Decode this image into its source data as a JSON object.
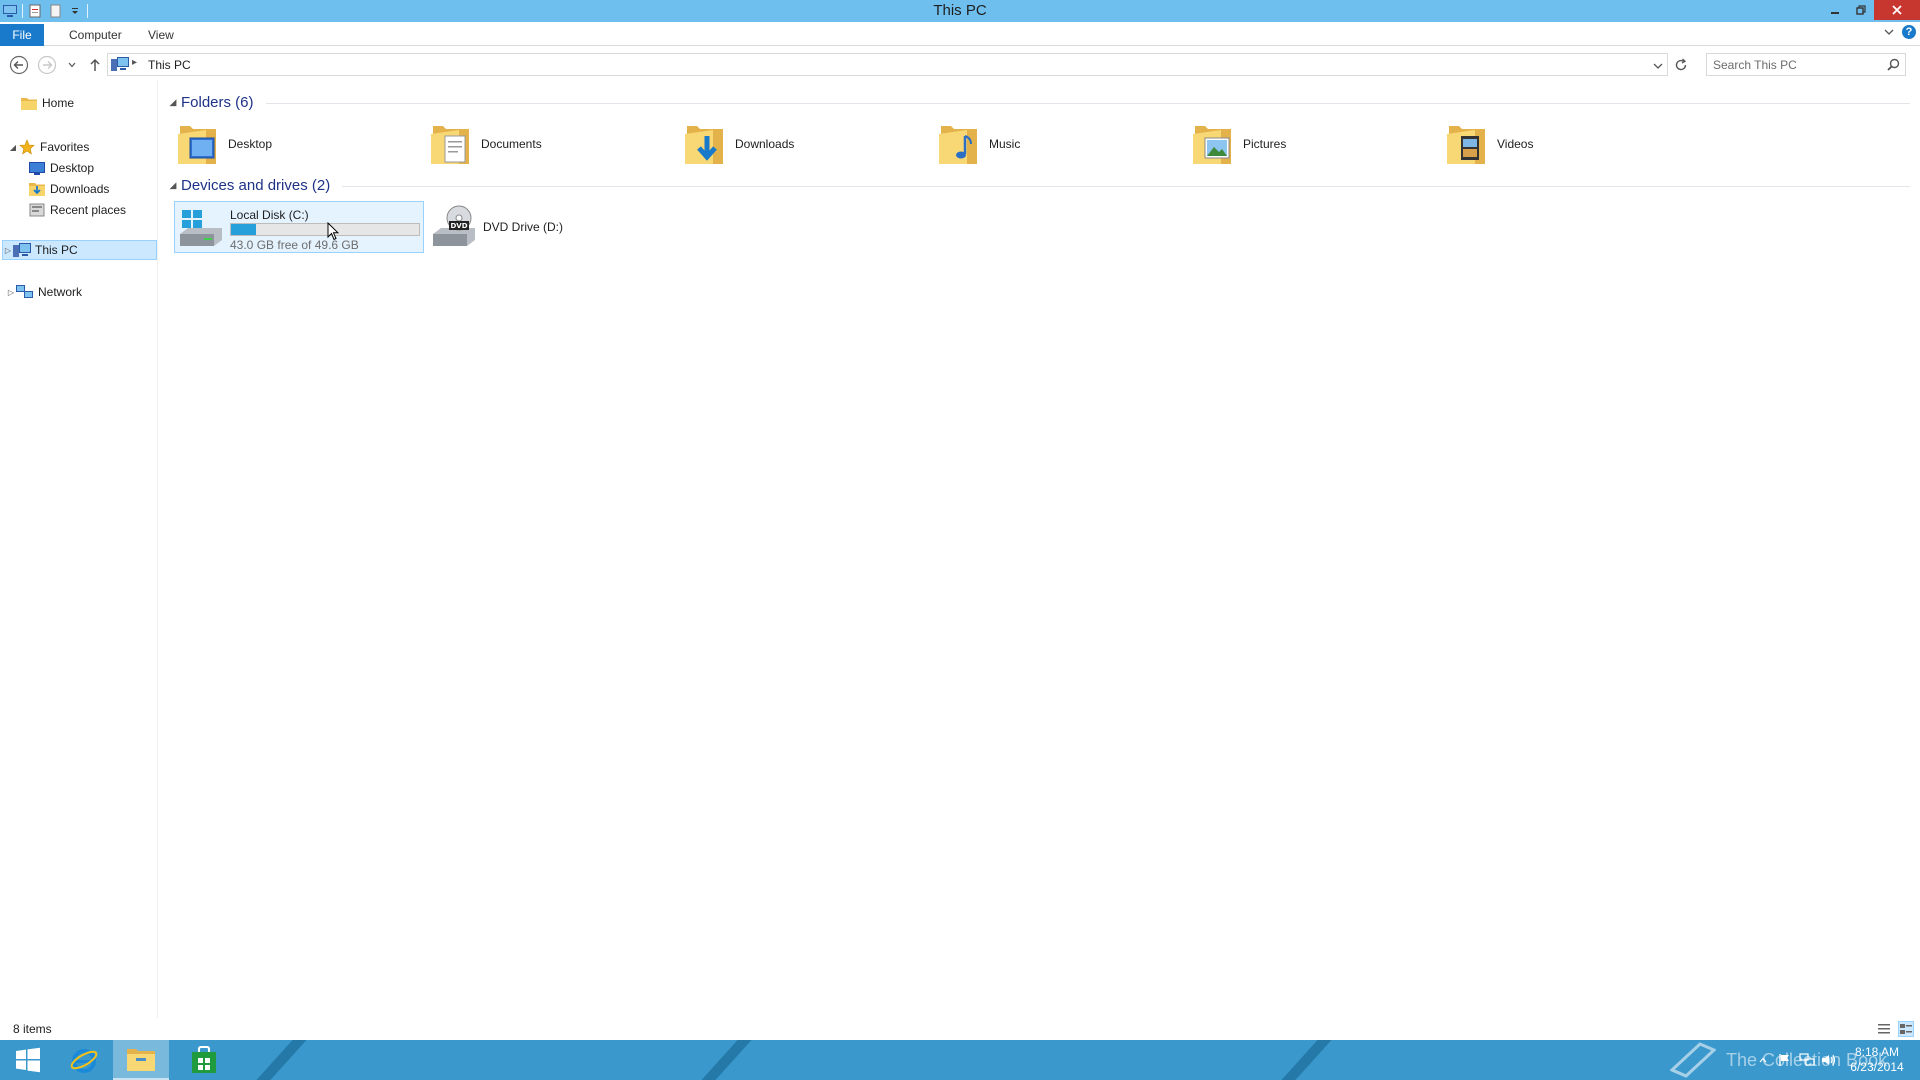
{
  "window": {
    "title": "This PC"
  },
  "ribbon": {
    "tabs": [
      "File",
      "Computer",
      "View"
    ]
  },
  "address": {
    "crumb": "This PC",
    "search_placeholder": "Search This PC"
  },
  "nav": {
    "home": "Home",
    "favorites": "Favorites",
    "favorites_items": [
      "Desktop",
      "Downloads",
      "Recent places"
    ],
    "this_pc": "This PC",
    "network": "Network"
  },
  "content": {
    "folders_header": "Folders (6)",
    "folders": [
      {
        "label": "Desktop",
        "icon": "folder-desktop-icon"
      },
      {
        "label": "Documents",
        "icon": "folder-documents-icon"
      },
      {
        "label": "Downloads",
        "icon": "folder-downloads-icon"
      },
      {
        "label": "Music",
        "icon": "folder-music-icon"
      },
      {
        "label": "Pictures",
        "icon": "folder-pictures-icon"
      },
      {
        "label": "Videos",
        "icon": "folder-videos-icon"
      }
    ],
    "devices_header": "Devices and drives (2)",
    "drives": [
      {
        "label": "Local Disk (C:)",
        "free_text": "43.0 GB free of 49.6 GB",
        "used_fraction": 0.133
      },
      {
        "label": "DVD Drive (D:)"
      }
    ]
  },
  "status": {
    "items": "8 items"
  },
  "taskbar": {
    "time": "8:18 AM",
    "date": "6/23/2014",
    "watermark": "The Collection Book"
  },
  "colors": {
    "titlebar": "#6ebfee",
    "file_tab": "#1979ca",
    "selection": "#cce8ff",
    "taskbar": "#3a98cc",
    "drive_bar": "#26a0da",
    "group_title": "#1e3287"
  }
}
